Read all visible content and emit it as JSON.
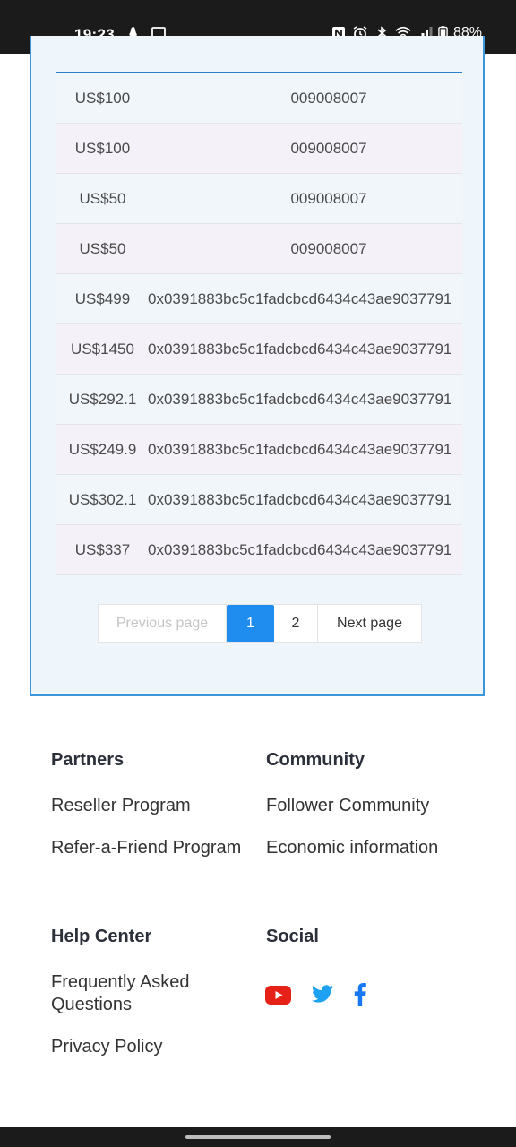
{
  "status_bar": {
    "time": "19:23",
    "battery": "88%"
  },
  "table": {
    "rows": [
      {
        "amount": "US$100",
        "address": "009008007"
      },
      {
        "amount": "US$100",
        "address": "009008007"
      },
      {
        "amount": "US$50",
        "address": "009008007"
      },
      {
        "amount": "US$50",
        "address": "009008007"
      },
      {
        "amount": "US$499",
        "address": "0x0391883bc5c1fadcbcd6434c43ae9037791"
      },
      {
        "amount": "US$1450",
        "address": "0x0391883bc5c1fadcbcd6434c43ae9037791"
      },
      {
        "amount": "US$292.1",
        "address": "0x0391883bc5c1fadcbcd6434c43ae9037791"
      },
      {
        "amount": "US$249.9",
        "address": "0x0391883bc5c1fadcbcd6434c43ae9037791"
      },
      {
        "amount": "US$302.1",
        "address": "0x0391883bc5c1fadcbcd6434c43ae9037791"
      },
      {
        "amount": "US$337",
        "address": "0x0391883bc5c1fadcbcd6434c43ae9037791"
      }
    ]
  },
  "pagination": {
    "prev_label": "Previous page",
    "pages": [
      "1",
      "2"
    ],
    "current_page": "1",
    "next_label": "Next page"
  },
  "footer": {
    "partners": {
      "title": "Partners",
      "links": [
        "Reseller Program",
        "Refer-a-Friend Program"
      ]
    },
    "community": {
      "title": "Community",
      "links": [
        "Follower Community",
        "Economic information"
      ]
    },
    "help": {
      "title": "Help Center",
      "links": [
        "Frequently Asked Questions",
        "Privacy Policy"
      ]
    },
    "social": {
      "title": "Social",
      "icons": [
        "youtube-icon",
        "twitter-icon",
        "facebook-icon"
      ]
    }
  },
  "colors": {
    "accent": "#1f8cf0",
    "card_border": "#3b97d9",
    "youtube": "#e62117",
    "twitter": "#1da1f2",
    "facebook": "#1877f2"
  }
}
